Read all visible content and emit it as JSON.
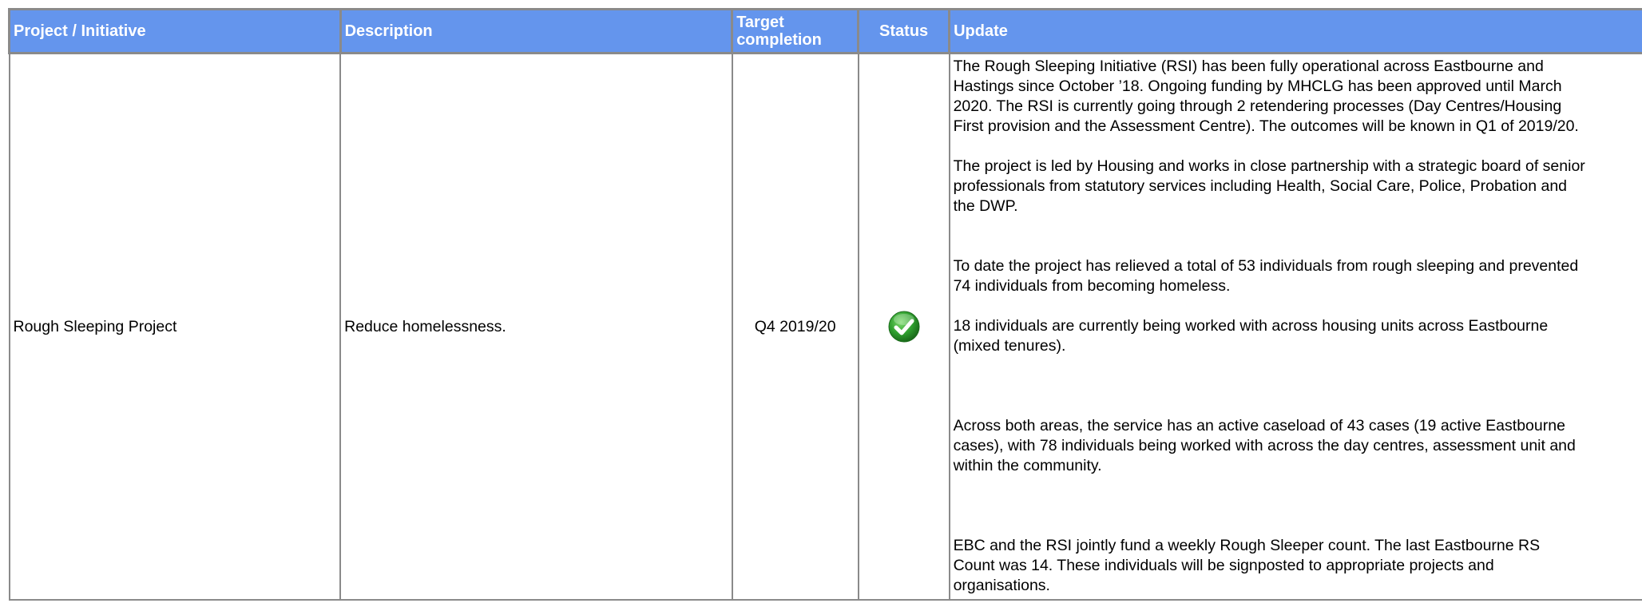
{
  "table": {
    "headers": {
      "project": "Project / Initiative",
      "description": "Description",
      "target": "Target completion",
      "status": "Status",
      "update": "Update"
    },
    "rows": [
      {
        "project": "Rough Sleeping Project",
        "description": "Reduce homelessness.",
        "target": "Q4 2019/20",
        "status_icon": "green-check-icon",
        "status_color": "#2e9e2e",
        "update_lines": [
          "The Rough Sleeping Initiative (RSI) has been fully operational across Eastbourne and",
          "Hastings since October ’18.  Ongoing funding by MHCLG has been approved until March",
          "2020.  The RSI is currently going through 2 retendering processes (Day Centres/Housing",
          "First provision and the Assessment Centre).  The outcomes will be known in Q1 of 2019/20.",
          "The project is led by Housing and works in close partnership with a strategic board of senior",
          "professionals from statutory services including Health, Social Care, Police, Probation and",
          "the DWP.",
          "To date the project has relieved a total of 53 individuals from rough sleeping and prevented",
          "74 individuals from becoming homeless.",
          "18 individuals are currently being worked with across housing units across Eastbourne",
          "(mixed tenures).",
          "Across both areas, the service has an active caseload of 43 cases (19 active Eastbourne",
          "cases), with 78 individuals being worked with across the day centres, assessment unit and",
          "within the community.",
          "EBC and the RSI jointly fund a weekly Rough Sleeper count.  The last Eastbourne RS",
          "Count  was 14.  These individuals will be signposted to appropriate projects and",
          "organisations."
        ]
      }
    ]
  },
  "colors": {
    "header_bg": "#6495ed",
    "header_text": "#ffffff",
    "grid": "#8a8a8a"
  }
}
